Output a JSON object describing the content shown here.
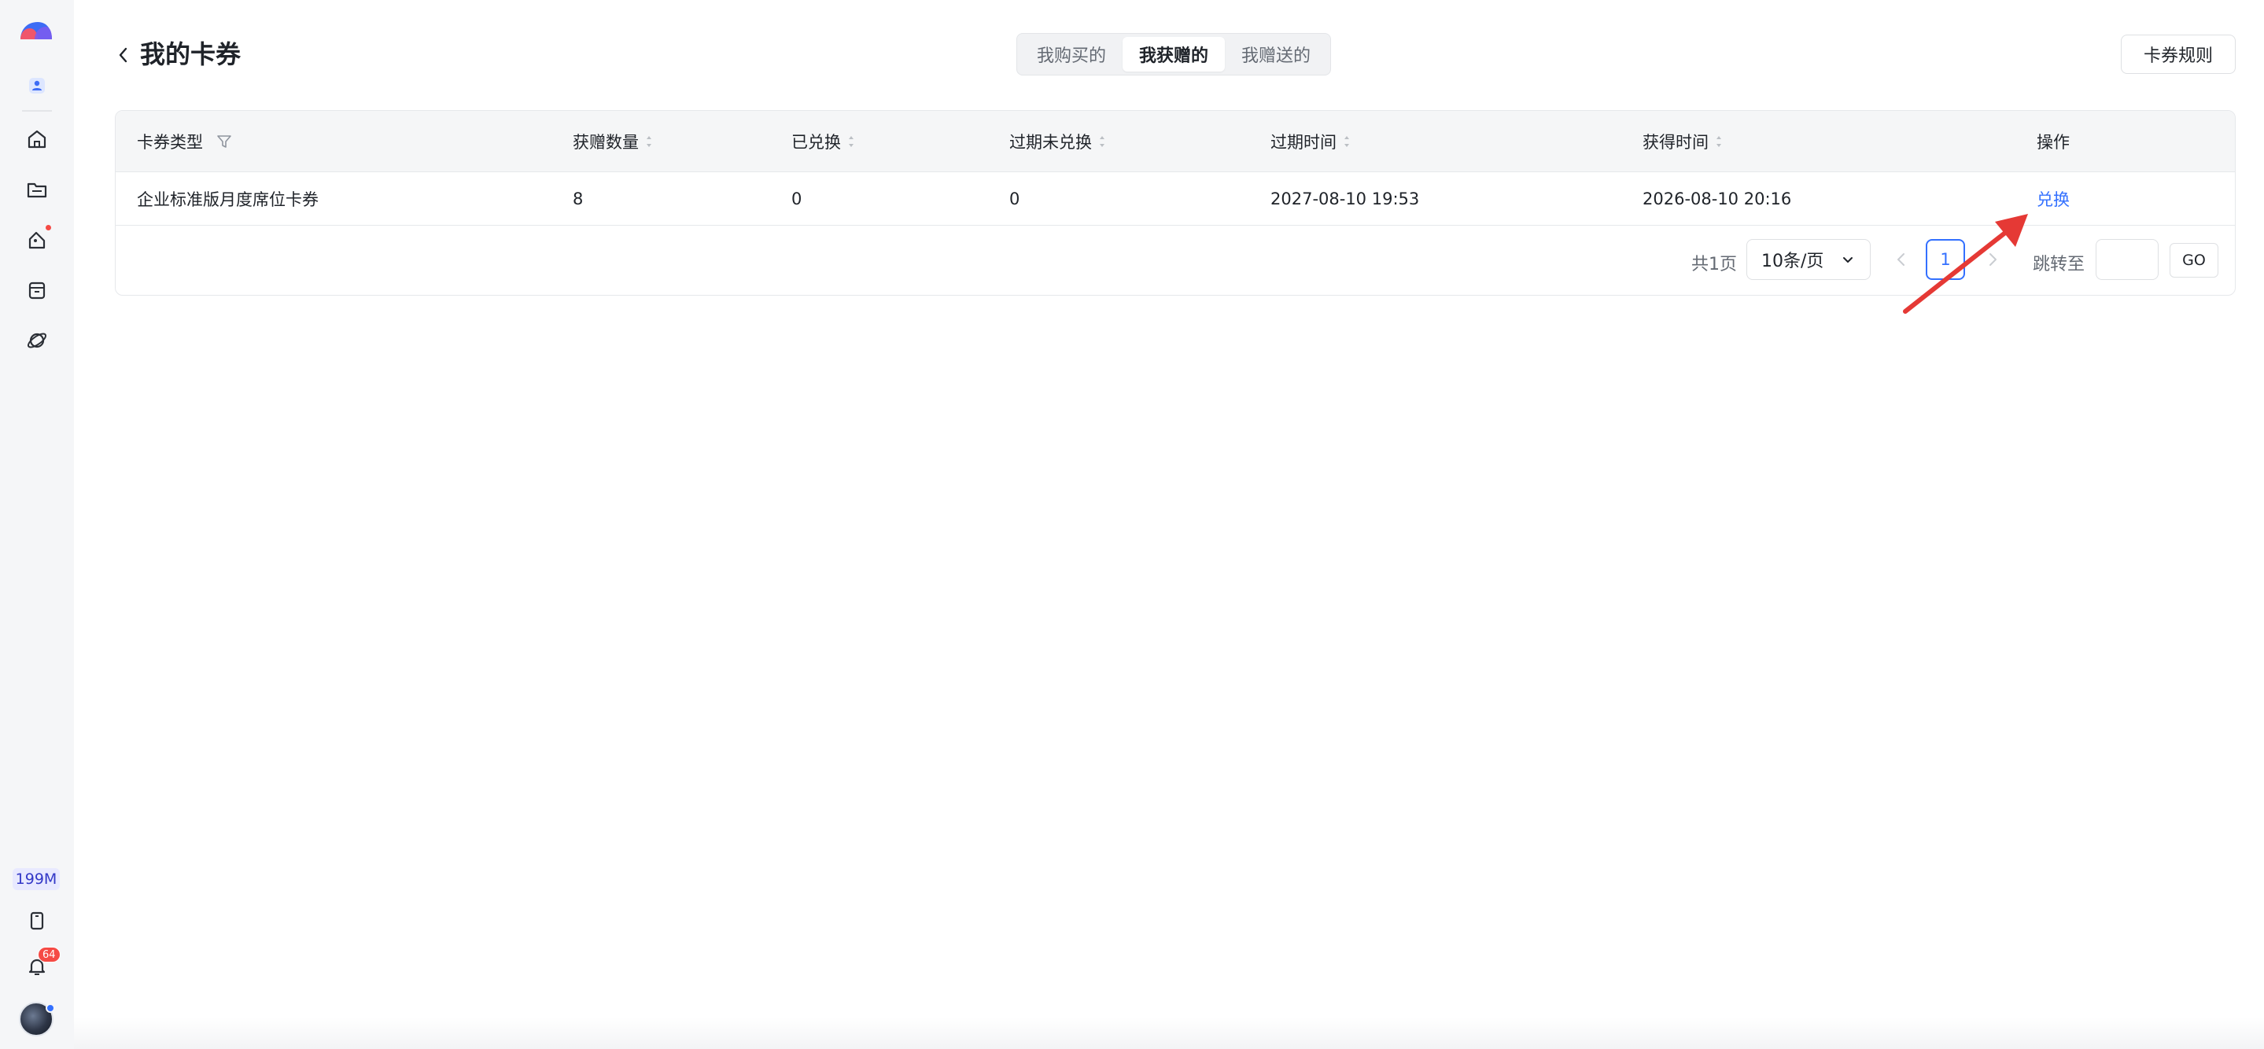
{
  "sidebar": {
    "storage_label": "199M",
    "notification_count": "64",
    "icons": [
      "logo",
      "contacts-icon",
      "home-icon",
      "folder-icon",
      "apps-icon",
      "archive-icon",
      "planet-icon",
      "tablet-icon",
      "bell-icon",
      "avatar"
    ]
  },
  "header": {
    "title": "我的卡券",
    "tabs": [
      {
        "label": "我购买的",
        "active": false
      },
      {
        "label": "我获赠的",
        "active": true
      },
      {
        "label": "我赠送的",
        "active": false
      }
    ],
    "rules_button": "卡券规则"
  },
  "table": {
    "columns": [
      {
        "label": "卡券类型",
        "filter": true
      },
      {
        "label": "获赠数量",
        "sortable": true
      },
      {
        "label": "已兑换",
        "sortable": true
      },
      {
        "label": "过期未兑换",
        "sortable": true
      },
      {
        "label": "过期时间",
        "sortable": true
      },
      {
        "label": "获得时间",
        "sortable": true
      },
      {
        "label": "操作"
      }
    ],
    "rows": [
      {
        "type": "企业标准版月度席位卡券",
        "received": "8",
        "redeemed": "0",
        "expired_unredeemed": "0",
        "expire_time": "2027-08-10 19:53",
        "obtained_time": "2026-08-10 20:16",
        "action": "兑换"
      }
    ]
  },
  "pagination": {
    "total_pages": "共1页",
    "page_size": "10条/页",
    "current_page": "1",
    "jump_label": "跳转至",
    "jump_value": "",
    "go_label": "GO"
  },
  "colors": {
    "accent": "#3370ff",
    "annotation_arrow": "#e53935",
    "badge_red": "#f54a45"
  }
}
